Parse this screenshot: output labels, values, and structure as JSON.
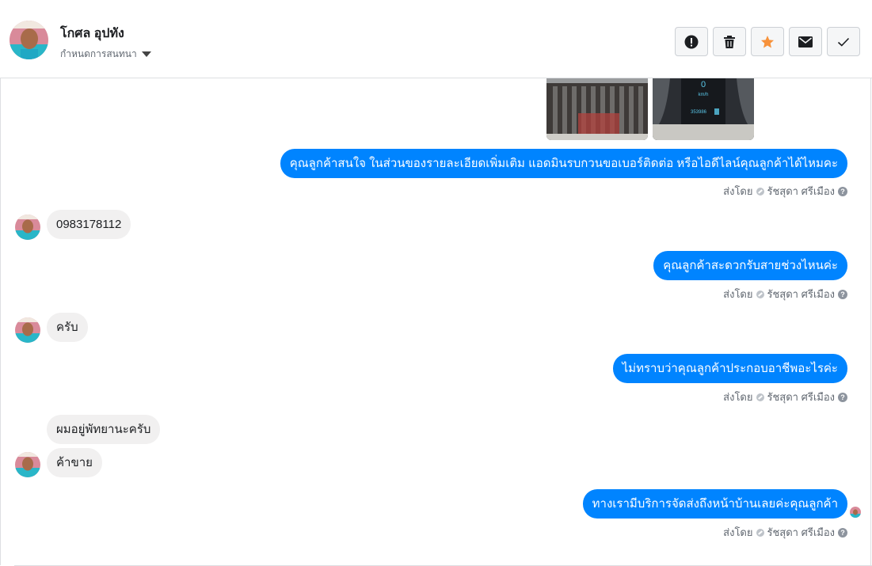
{
  "header": {
    "name": "โกศล อุปทัง",
    "assign_label": "กำหนดการสนทนา",
    "actions": [
      "mark-spam",
      "delete",
      "star",
      "mark-unread",
      "mark-done"
    ]
  },
  "messages": {
    "out1": "คุณลูกค้าสนใจ ในส่วนของรายละเอียดเพิ่มเติม แอดมินรบกวนขอเบอร์ติดต่อ หรือไอดีไลน์คุณลูกค้าได้ไหมคะ",
    "in1": "0983178112",
    "out2": "คุณลูกค้าสะดวกรับสายช่วงไหนค่ะ",
    "in2": "ครับ",
    "out3": "ไม่ทราบว่าคุณลูกค้าประกอบอาชีพอะไรค่ะ",
    "in3a": "ผมอยู่พัทยานะครับ",
    "in3b": "ค้าขาย",
    "out4": "ทางเรามีบริการจัดส่งถึงหน้าบ้านเลยค่ะคุณลูกค้า"
  },
  "sent_by": {
    "prefix": "ส่งโดย",
    "agent": "รัชสุดา ศรีเมือง"
  },
  "dashboard": {
    "speed": "0",
    "unit": "km/h",
    "odometer": "353986"
  },
  "colors": {
    "outgoing_bubble": "#0084ff",
    "incoming_bubble": "#f1f0f0",
    "star": "#f7923b"
  }
}
